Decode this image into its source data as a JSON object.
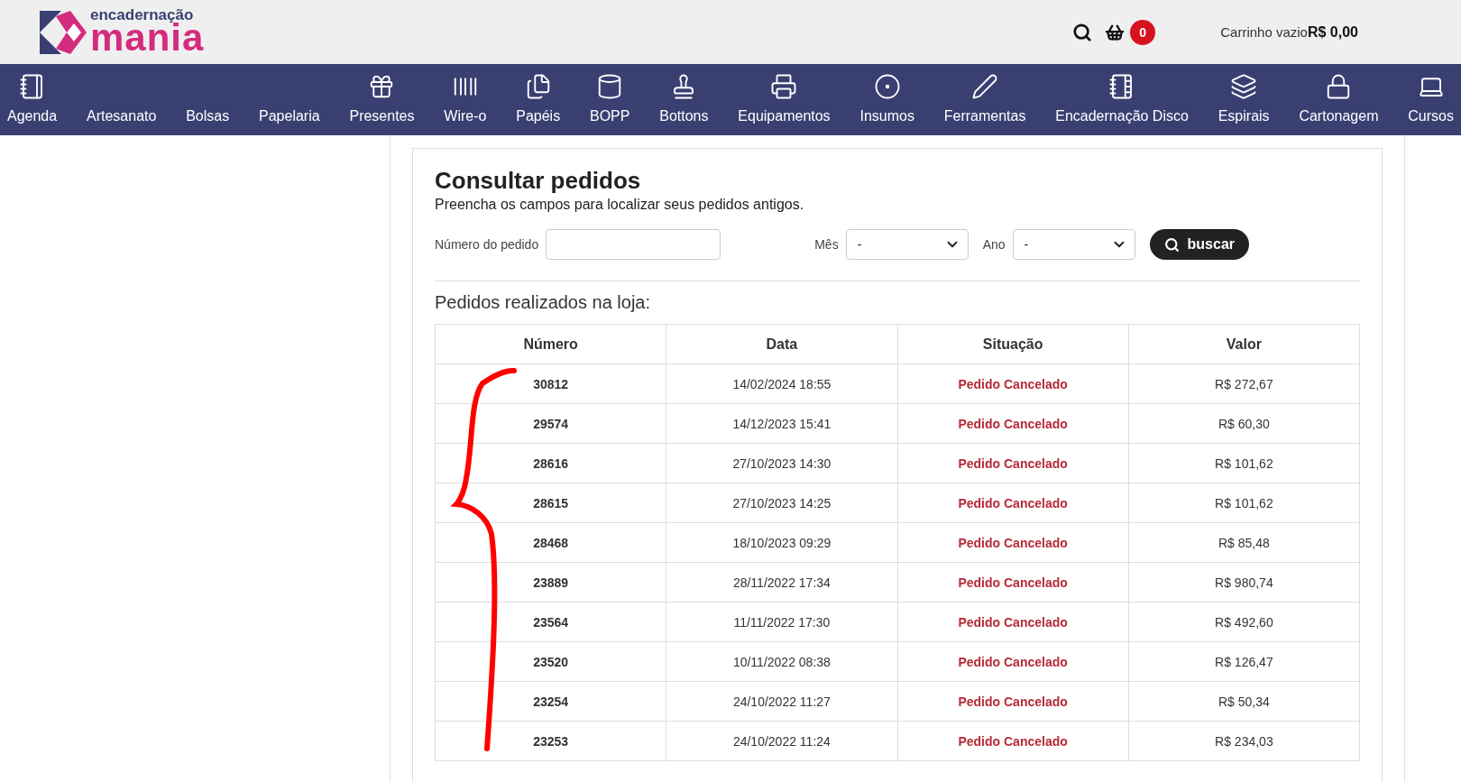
{
  "logo": {
    "small": "encadernação",
    "big": "mania"
  },
  "header": {
    "cart_count": "0",
    "cart_label": "Carrinho vazio",
    "cart_total": "R$ 0,00"
  },
  "nav": [
    {
      "label": "Agenda"
    },
    {
      "label": "Artesanato"
    },
    {
      "label": "Bolsas"
    },
    {
      "label": "Papelaria"
    },
    {
      "label": "Presentes"
    },
    {
      "label": "Wire-o"
    },
    {
      "label": "Papéis"
    },
    {
      "label": "BOPP"
    },
    {
      "label": "Bottons"
    },
    {
      "label": "Equipamentos"
    },
    {
      "label": "Insumos"
    },
    {
      "label": "Ferramentas"
    },
    {
      "label": "Encadernação Disco"
    },
    {
      "label": "Espirais"
    },
    {
      "label": "Cartonagem"
    },
    {
      "label": "Cursos"
    }
  ],
  "page": {
    "title": "Consultar pedidos",
    "subtitle": "Preencha os campos para localizar seus pedidos antigos."
  },
  "form": {
    "order_label": "Número do pedido",
    "month_label": "Mês",
    "month_value": "-",
    "year_label": "Ano",
    "year_value": "-",
    "button": "buscar"
  },
  "orders": {
    "heading": "Pedidos realizados na loja:",
    "columns": [
      "Número",
      "Data",
      "Situação",
      "Valor"
    ],
    "rows": [
      {
        "number": "30812",
        "date": "14/02/2024 18:55",
        "status": "Pedido Cancelado",
        "value": "R$ 272,67"
      },
      {
        "number": "29574",
        "date": "14/12/2023 15:41",
        "status": "Pedido Cancelado",
        "value": "R$ 60,30"
      },
      {
        "number": "28616",
        "date": "27/10/2023 14:30",
        "status": "Pedido Cancelado",
        "value": "R$ 101,62"
      },
      {
        "number": "28615",
        "date": "27/10/2023 14:25",
        "status": "Pedido Cancelado",
        "value": "R$ 101,62"
      },
      {
        "number": "28468",
        "date": "18/10/2023 09:29",
        "status": "Pedido Cancelado",
        "value": "R$ 85,48"
      },
      {
        "number": "23889",
        "date": "28/11/2022 17:34",
        "status": "Pedido Cancelado",
        "value": "R$ 980,74"
      },
      {
        "number": "23564",
        "date": "11/11/2022 17:30",
        "status": "Pedido Cancelado",
        "value": "R$ 492,60"
      },
      {
        "number": "23520",
        "date": "10/11/2022 08:38",
        "status": "Pedido Cancelado",
        "value": "R$ 126,47"
      },
      {
        "number": "23254",
        "date": "24/10/2022 11:27",
        "status": "Pedido Cancelado",
        "value": "R$ 50,34"
      },
      {
        "number": "23253",
        "date": "24/10/2022 11:24",
        "status": "Pedido Cancelado",
        "value": "R$ 234,03"
      }
    ]
  }
}
